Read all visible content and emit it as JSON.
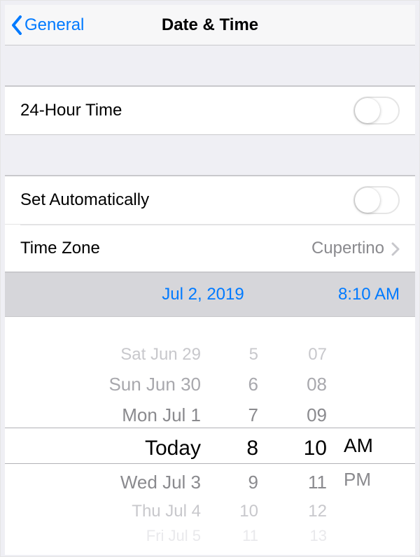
{
  "nav": {
    "back_label": "General",
    "title": "Date & Time"
  },
  "rows": {
    "twenty_four_hour_label": "24-Hour Time",
    "set_automatically_label": "Set Automatically",
    "time_zone_label": "Time Zone",
    "time_zone_value": "Cupertino"
  },
  "selected": {
    "date": "Jul 2, 2019",
    "time": "8:10 AM"
  },
  "picker": {
    "dates": [
      "",
      "Sat Jun 29",
      "Sun Jun 30",
      "Mon Jul 1",
      "Today",
      "Wed Jul 3",
      "Thu Jul 4",
      "Fri Jul 5"
    ],
    "hours": [
      "",
      "5",
      "6",
      "7",
      "8",
      "9",
      "10",
      "11"
    ],
    "minutes": [
      "",
      "07",
      "08",
      "09",
      "10",
      "11",
      "12",
      "13"
    ],
    "ampm": [
      "AM",
      "PM"
    ]
  }
}
